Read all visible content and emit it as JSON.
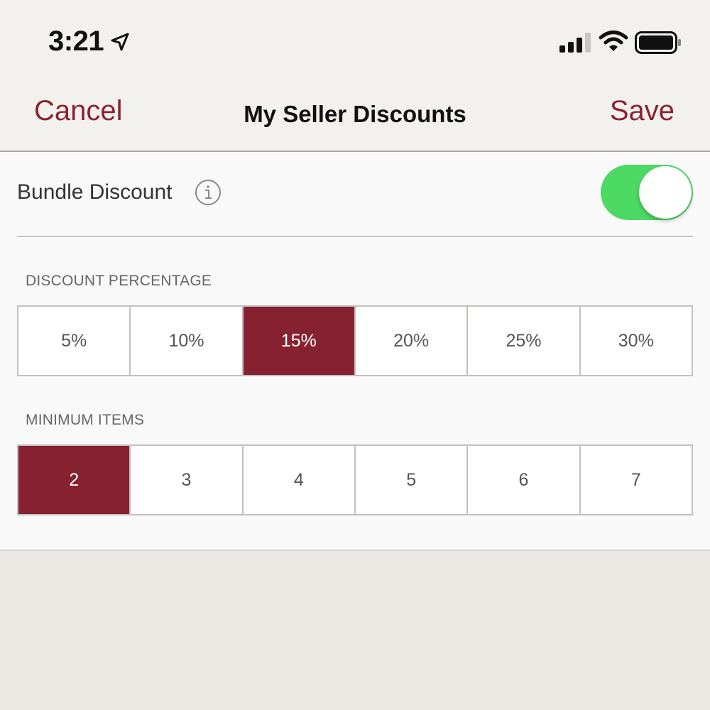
{
  "status": {
    "time": "3:21"
  },
  "nav": {
    "cancel_label": "Cancel",
    "title": "My Seller Discounts",
    "save_label": "Save"
  },
  "bundle": {
    "label": "Bundle Discount",
    "enabled": true
  },
  "discount": {
    "label": "DISCOUNT PERCENTAGE",
    "options": [
      "5%",
      "10%",
      "15%",
      "20%",
      "25%",
      "30%"
    ],
    "selected": "15%"
  },
  "minimum": {
    "label": "MINIMUM ITEMS",
    "options": [
      "2",
      "3",
      "4",
      "5",
      "6",
      "7"
    ],
    "selected": "2"
  },
  "colors": {
    "accent": "#8b2332",
    "selected_fill": "#862230",
    "toggle_on": "#4cd964"
  },
  "icons": {
    "location": "location-arrow-icon",
    "signal": "cellular-signal-icon",
    "wifi": "wifi-icon",
    "battery": "battery-icon",
    "info": "info-icon"
  }
}
